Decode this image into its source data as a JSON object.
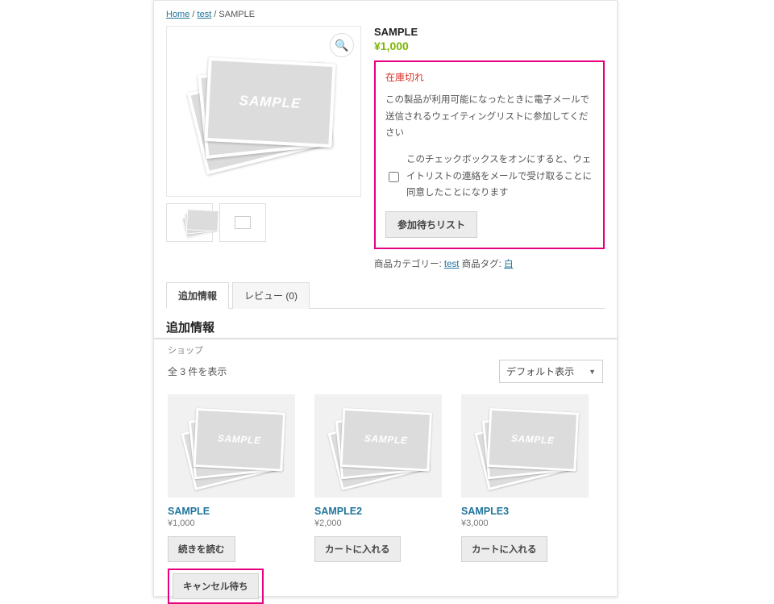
{
  "breadcrumb": {
    "home": "Home",
    "cat": "test",
    "current": "SAMPLE"
  },
  "product": {
    "title": "SAMPLE",
    "gallery_label": "SAMPLE",
    "price": "¥1,000",
    "out_of_stock": "在庫切れ",
    "waitlist_desc": "この製品が利用可能になったときに電子メールで送信されるウェイティングリストに参加してください",
    "consent_text": "このチェックボックスをオンにすると、ウェイトリストの連絡をメールで受け取ることに同意したことになります",
    "join_button": "参加待ちリスト",
    "meta_cat_label": "商品カテゴリー:",
    "meta_cat_value": "test",
    "meta_tag_label": "商品タグ:",
    "meta_tag_value": "白"
  },
  "tabs": {
    "info": "追加情報",
    "reviews": "レビュー (0)",
    "heading": "追加情報"
  },
  "shop": {
    "heading": "ショップ",
    "result_count": "全 3 件を表示",
    "sort_label": "デフォルト表示",
    "items": [
      {
        "title": "SAMPLE",
        "price": "¥1,000",
        "button": "続きを読む",
        "cancel_wait": "キャンセル待ち",
        "img_label": "SAMPLE"
      },
      {
        "title": "SAMPLE2",
        "price": "¥2,000",
        "button": "カートに入れる",
        "img_label": "SAMPLE"
      },
      {
        "title": "SAMPLE3",
        "price": "¥3,000",
        "button": "カートに入れる",
        "img_label": "SAMPLE"
      }
    ]
  }
}
